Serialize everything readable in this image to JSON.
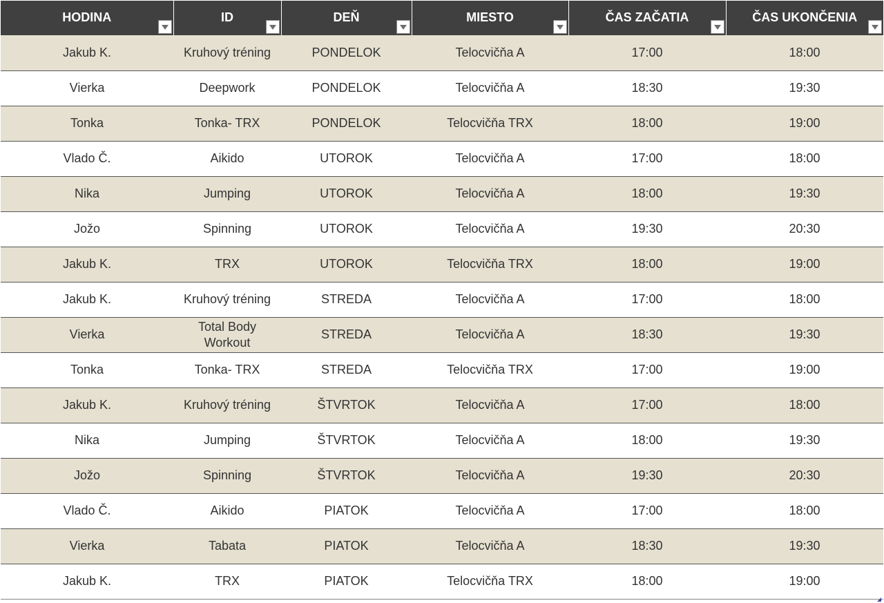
{
  "table": {
    "columns": [
      {
        "key": "hodina",
        "label": "HODINA"
      },
      {
        "key": "id",
        "label": "ID"
      },
      {
        "key": "den",
        "label": "DEŇ"
      },
      {
        "key": "miesto",
        "label": "MIESTO"
      },
      {
        "key": "cas_zacatia",
        "label": "ČAS ZAČATIA"
      },
      {
        "key": "cas_ukoncenia",
        "label": "ČAS UKONČENIA"
      }
    ],
    "rows": [
      [
        "Jakub K.",
        "Kruhový tréning",
        "PONDELOK",
        "Telocvičňa A",
        "17:00",
        "18:00"
      ],
      [
        "Vierka",
        "Deepwork",
        "PONDELOK",
        "Telocvičňa A",
        "18:30",
        "19:30"
      ],
      [
        "Tonka",
        "Tonka- TRX",
        "PONDELOK",
        "Telocvičňa TRX",
        "18:00",
        "19:00"
      ],
      [
        "Vlado Č.",
        "Aikido",
        "UTOROK",
        "Telocvičňa A",
        "17:00",
        "18:00"
      ],
      [
        "Nika",
        "Jumping",
        "UTOROK",
        "Telocvičňa A",
        "18:00",
        "19:30"
      ],
      [
        "Jožo",
        "Spinning",
        "UTOROK",
        "Telocvičňa A",
        "19:30",
        "20:30"
      ],
      [
        "Jakub K.",
        "TRX",
        "UTOROK",
        "Telocvičňa TRX",
        "18:00",
        "19:00"
      ],
      [
        "Jakub K.",
        "Kruhový tréning",
        "STREDA",
        "Telocvičňa A",
        "17:00",
        "18:00"
      ],
      [
        "Vierka",
        "Total Body Workout",
        "STREDA",
        "Telocvičňa A",
        "18:30",
        "19:30"
      ],
      [
        "Tonka",
        "Tonka- TRX",
        "STREDA",
        "Telocvičňa TRX",
        "17:00",
        "19:00"
      ],
      [
        "Jakub K.",
        "Kruhový tréning",
        "ŠTVRTOK",
        "Telocvičňa A",
        "17:00",
        "18:00"
      ],
      [
        "Nika",
        "Jumping",
        "ŠTVRTOK",
        "Telocvičňa A",
        "18:00",
        "19:30"
      ],
      [
        "Jožo",
        "Spinning",
        "ŠTVRTOK",
        "Telocvičňa A",
        "19:30",
        "20:30"
      ],
      [
        "Vlado Č.",
        "Aikido",
        "PIATOK",
        "Telocvičňa A",
        "17:00",
        "18:00"
      ],
      [
        "Vierka",
        "Tabata",
        "PIATOK",
        "Telocvičňa A",
        "18:30",
        "19:30"
      ],
      [
        "Jakub K.",
        "TRX",
        "PIATOK",
        "Telocvičňa TRX",
        "18:00",
        "19:00"
      ]
    ]
  },
  "icons": {
    "filter": "chevron-down-icon",
    "resize": "resize-handle-icon"
  },
  "colors": {
    "header_bg": "#404040",
    "header_text": "#ffffff",
    "band_odd": "#e5e0d0",
    "band_even": "#ffffff",
    "cell_text": "#333333"
  }
}
